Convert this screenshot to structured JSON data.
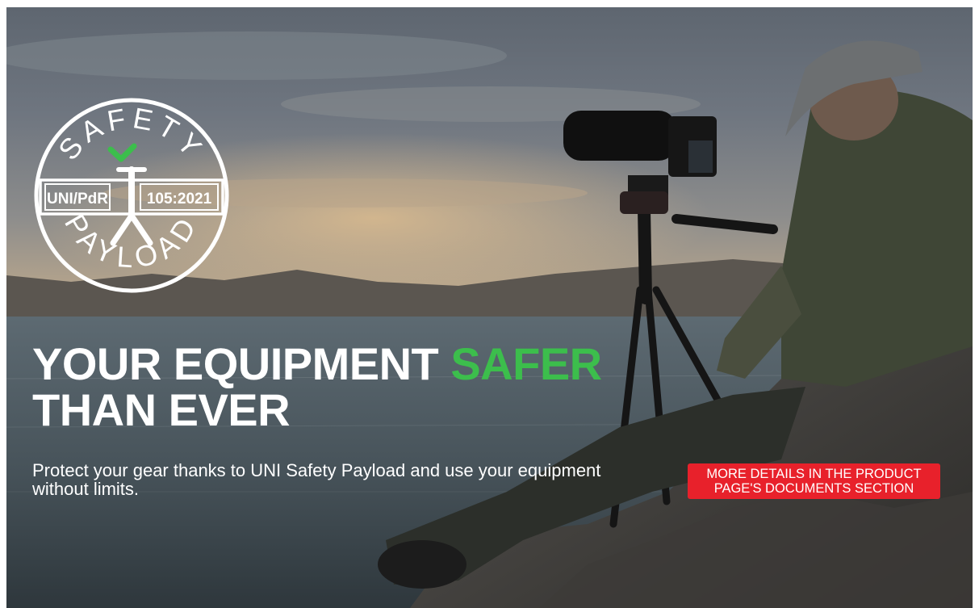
{
  "badge": {
    "top_text": "SAFETY",
    "bottom_text": "PAYLOAD",
    "left_code": "UNI/PdR",
    "right_code": "105:2021",
    "check_color": "#3cbe4c"
  },
  "headline": {
    "line1_prefix": "YOUR EQUIPMENT",
    "line1_accent": "SAFER",
    "line2": "THAN EVER",
    "accent_color": "#3cbe4c"
  },
  "subtext": "Protect your gear thanks to UNI Safety Payload and use your equipment without limits.",
  "details_button": {
    "line1": "MORE DETAILS IN THE PRODUCT",
    "line2": "PAGE'S DOCUMENTS SECTION",
    "color": "#e8212b"
  }
}
